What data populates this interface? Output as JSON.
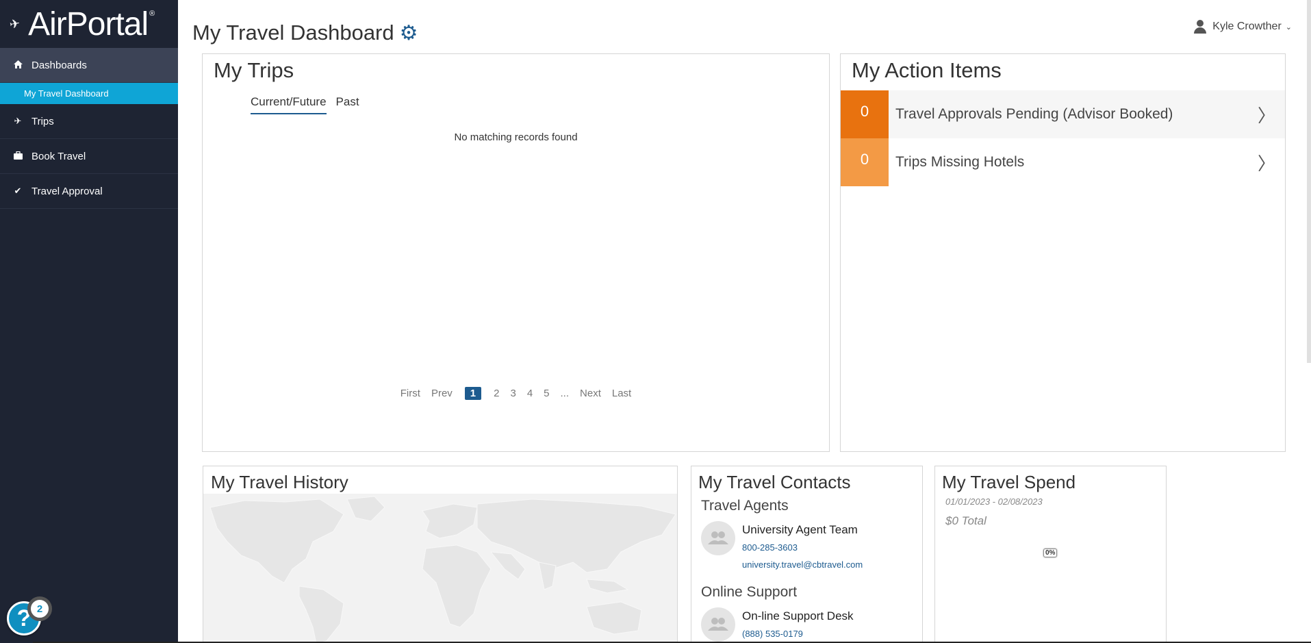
{
  "app": {
    "logo_text": "AirPortal",
    "logo_reg": "®"
  },
  "sidebar": {
    "items": [
      {
        "label": "Dashboards",
        "icon": "home-icon"
      },
      {
        "label": "My Travel Dashboard"
      },
      {
        "label": "Trips",
        "icon": "plane-icon"
      },
      {
        "label": "Book Travel",
        "icon": "briefcase-icon"
      },
      {
        "label": "Travel Approval",
        "icon": "check-icon"
      }
    ]
  },
  "header": {
    "title": "My Travel Dashboard",
    "user_name": "Kyle Crowther"
  },
  "help": {
    "symbol": "?",
    "badge": "2"
  },
  "trips": {
    "title": "My Trips",
    "tabs": [
      "Current/Future",
      "Past"
    ],
    "active_tab": "Current/Future",
    "empty_text": "No matching records found",
    "pager": {
      "first": "First",
      "prev": "Prev",
      "pages": [
        "1",
        "2",
        "3",
        "4",
        "5"
      ],
      "ellipsis": "...",
      "next": "Next",
      "last": "Last",
      "current": "1"
    }
  },
  "actions": {
    "title": "My Action Items",
    "items": [
      {
        "count": "0",
        "label": "Travel Approvals Pending (Advisor Booked)",
        "color": "#e8720f"
      },
      {
        "count": "0",
        "label": "Trips Missing Hotels",
        "color": "#f39a45"
      }
    ]
  },
  "history": {
    "title": "My Travel History"
  },
  "contacts": {
    "title": "My Travel Contacts",
    "sections": [
      {
        "heading": "Travel Agents",
        "name": "University Agent Team",
        "phone": "800-285-3603",
        "email": "university.travel@cbtravel.com"
      },
      {
        "heading": "Online Support",
        "name": "On-line Support Desk",
        "phone": "(888) 535-0179"
      }
    ]
  },
  "spend": {
    "title": "My Travel Spend",
    "range": "01/01/2023 - 02/08/2023",
    "total": "$0 Total",
    "percent": "0%"
  },
  "colors": {
    "sidebar_bg": "#1e2433",
    "sidebar_active_sub": "#0fa5d6",
    "accent": "#1d5b8f"
  }
}
